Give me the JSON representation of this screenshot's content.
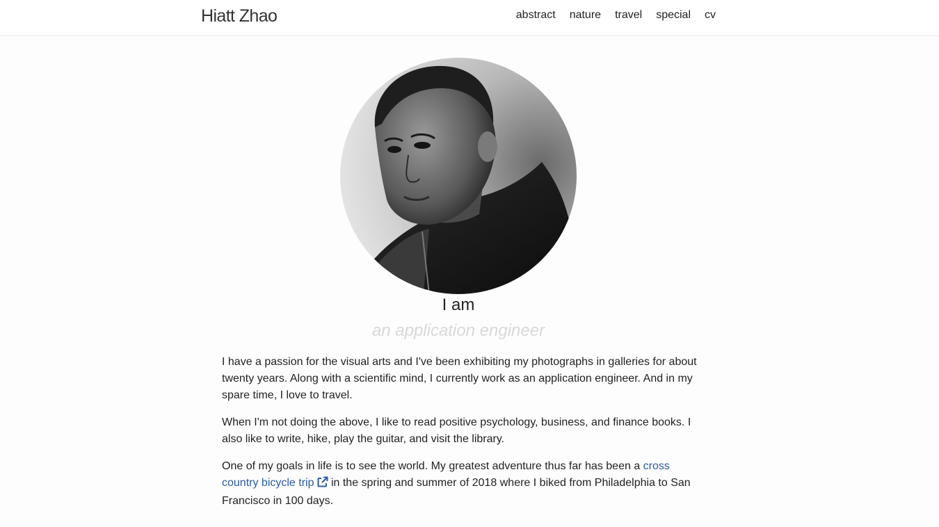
{
  "site": {
    "brand": "Hiatt Zhao"
  },
  "nav": {
    "items": [
      "abstract",
      "nature",
      "travel",
      "special",
      "cv"
    ]
  },
  "profile": {
    "heading": "I am",
    "role": "an application engineer"
  },
  "about": {
    "p1": "I have a passion for the visual arts and I've been exhibiting my photographs in galleries for about twenty years. Along with a scientific mind, I currently work as an application engineer. And in my spare time, I love to travel.",
    "p2": "When I'm not doing the above, I like to read positive psychology, business, and finance books. I also like to write, hike, play the guitar, and visit the library.",
    "p3_before": "One of my goals in life is to see the world. My greatest adventure thus far has been a ",
    "p3_link": "cross country bicycle trip",
    "p3_after": " in the spring and summer of 2018 where I biked from Philadelphia to San Francisco in 100 days."
  },
  "colors": {
    "link": "#2c5aa0",
    "role_text": "#d8d8d8"
  },
  "icons": {
    "link_icon": "external-link-icon"
  }
}
